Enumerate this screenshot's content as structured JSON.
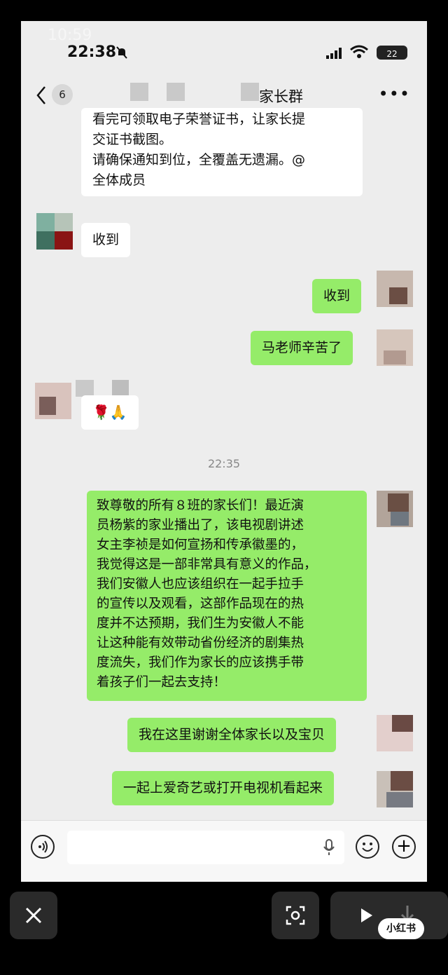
{
  "status": {
    "ghost_time": "10:59",
    "time": "22:38",
    "battery": "22"
  },
  "nav": {
    "back_badge": "6",
    "title": "家长群",
    "more": "•••"
  },
  "messages": {
    "m1_line1": "看完可领取电子荣誉证书，让家长提",
    "m1_line2": "交证书截图。",
    "m1_line3": "请确保通知到位，全覆盖无遗漏。@",
    "m1_line4": "全体成员",
    "m2": "收到",
    "m3": "收到",
    "m4": "马老师辛苦了",
    "m5": "🌹🙏",
    "timestamp": "22:35",
    "m6": [
      "致尊敬的所有８班的家长们！最近演",
      "员杨紫的家业播出了，该电视剧讲述",
      "女主李祯是如何宣扬和传承徽墨的，",
      "我觉得这是一部非常具有意义的作品，",
      "我们安徽人也应该组织在一起手拉手",
      "的宣传以及观看，这部作品现在的热",
      "度并不达预期，我们生为安徽人不能",
      "让这种能有效带动省份经济的剧集热",
      "度流失，我们作为家长的应该携手带",
      "着孩子们一起去支持！"
    ],
    "m7": "我在这里谢谢全体家长以及宝贝",
    "m8": "一起上爱奇艺或打开电视机看起来"
  },
  "watermark": "小红书"
}
